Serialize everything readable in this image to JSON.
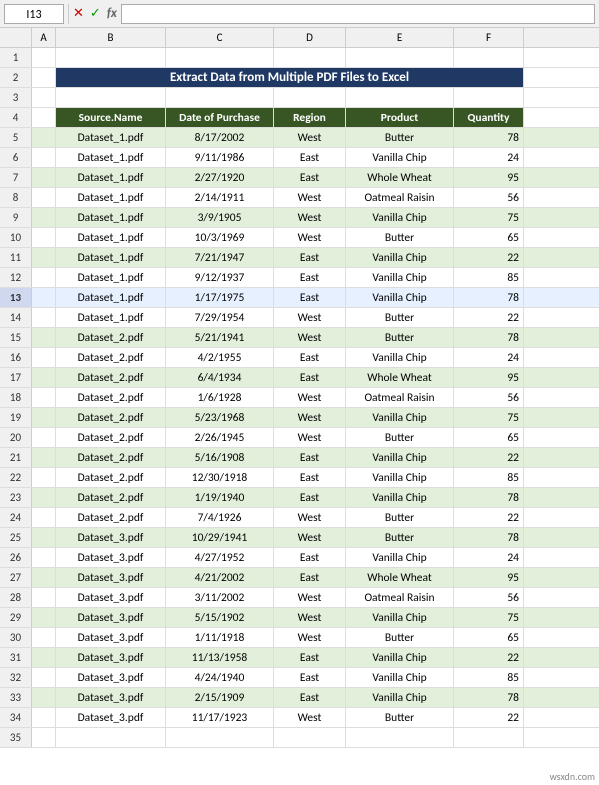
{
  "cellRef": "I13",
  "formulaBar": "",
  "title": "Extract Data from Multiple PDF Files to Excel",
  "columns": [
    {
      "id": "A",
      "label": "A",
      "class": "col-a"
    },
    {
      "id": "B",
      "label": "B",
      "class": "col-b"
    },
    {
      "id": "C",
      "label": "C",
      "class": "col-c"
    },
    {
      "id": "D",
      "label": "D",
      "class": "col-d"
    },
    {
      "id": "E",
      "label": "E",
      "class": "col-e"
    },
    {
      "id": "F",
      "label": "F",
      "class": "col-f"
    }
  ],
  "headers": [
    "Source.Name",
    "Date of Purchase",
    "Region",
    "Product",
    "Quantity"
  ],
  "rows": [
    {
      "num": 1,
      "type": "empty"
    },
    {
      "num": 2,
      "type": "title"
    },
    {
      "num": 3,
      "type": "empty"
    },
    {
      "num": 4,
      "type": "header"
    },
    {
      "num": 5,
      "type": "data",
      "src": "Dataset_1.pdf",
      "date": "8/17/2002",
      "region": "West",
      "product": "Butter",
      "qty": "78"
    },
    {
      "num": 6,
      "type": "data",
      "src": "Dataset_1.pdf",
      "date": "9/11/1986",
      "region": "East",
      "product": "Vanilla Chip",
      "qty": "24"
    },
    {
      "num": 7,
      "type": "data",
      "src": "Dataset_1.pdf",
      "date": "2/27/1920",
      "region": "East",
      "product": "Whole Wheat",
      "qty": "95"
    },
    {
      "num": 8,
      "type": "data",
      "src": "Dataset_1.pdf",
      "date": "2/14/1911",
      "region": "West",
      "product": "Oatmeal Raisin",
      "qty": "56"
    },
    {
      "num": 9,
      "type": "data",
      "src": "Dataset_1.pdf",
      "date": "3/9/1905",
      "region": "West",
      "product": "Vanilla Chip",
      "qty": "75"
    },
    {
      "num": 10,
      "type": "data",
      "src": "Dataset_1.pdf",
      "date": "10/3/1969",
      "region": "West",
      "product": "Butter",
      "qty": "65"
    },
    {
      "num": 11,
      "type": "data",
      "src": "Dataset_1.pdf",
      "date": "7/21/1947",
      "region": "East",
      "product": "Vanilla Chip",
      "qty": "22"
    },
    {
      "num": 12,
      "type": "data",
      "src": "Dataset_1.pdf",
      "date": "9/12/1937",
      "region": "East",
      "product": "Vanilla Chip",
      "qty": "85"
    },
    {
      "num": 13,
      "type": "data",
      "src": "Dataset_1.pdf",
      "date": "1/17/1975",
      "region": "East",
      "product": "Vanilla Chip",
      "qty": "78",
      "selected": true
    },
    {
      "num": 14,
      "type": "data",
      "src": "Dataset_1.pdf",
      "date": "7/29/1954",
      "region": "West",
      "product": "Butter",
      "qty": "22"
    },
    {
      "num": 15,
      "type": "data",
      "src": "Dataset_2.pdf",
      "date": "5/21/1941",
      "region": "West",
      "product": "Butter",
      "qty": "78"
    },
    {
      "num": 16,
      "type": "data",
      "src": "Dataset_2.pdf",
      "date": "4/2/1955",
      "region": "East",
      "product": "Vanilla Chip",
      "qty": "24"
    },
    {
      "num": 17,
      "type": "data",
      "src": "Dataset_2.pdf",
      "date": "6/4/1934",
      "region": "East",
      "product": "Whole Wheat",
      "qty": "95"
    },
    {
      "num": 18,
      "type": "data",
      "src": "Dataset_2.pdf",
      "date": "1/6/1928",
      "region": "West",
      "product": "Oatmeal Raisin",
      "qty": "56"
    },
    {
      "num": 19,
      "type": "data",
      "src": "Dataset_2.pdf",
      "date": "5/23/1968",
      "region": "West",
      "product": "Vanilla Chip",
      "qty": "75"
    },
    {
      "num": 20,
      "type": "data",
      "src": "Dataset_2.pdf",
      "date": "2/26/1945",
      "region": "West",
      "product": "Butter",
      "qty": "65"
    },
    {
      "num": 21,
      "type": "data",
      "src": "Dataset_2.pdf",
      "date": "5/16/1908",
      "region": "East",
      "product": "Vanilla Chip",
      "qty": "22"
    },
    {
      "num": 22,
      "type": "data",
      "src": "Dataset_2.pdf",
      "date": "12/30/1918",
      "region": "East",
      "product": "Vanilla Chip",
      "qty": "85"
    },
    {
      "num": 23,
      "type": "data",
      "src": "Dataset_2.pdf",
      "date": "1/19/1940",
      "region": "East",
      "product": "Vanilla Chip",
      "qty": "78"
    },
    {
      "num": 24,
      "type": "data",
      "src": "Dataset_2.pdf",
      "date": "7/4/1926",
      "region": "West",
      "product": "Butter",
      "qty": "22"
    },
    {
      "num": 25,
      "type": "data",
      "src": "Dataset_3.pdf",
      "date": "10/29/1941",
      "region": "West",
      "product": "Butter",
      "qty": "78"
    },
    {
      "num": 26,
      "type": "data",
      "src": "Dataset_3.pdf",
      "date": "4/27/1952",
      "region": "East",
      "product": "Vanilla Chip",
      "qty": "24"
    },
    {
      "num": 27,
      "type": "data",
      "src": "Dataset_3.pdf",
      "date": "4/21/2002",
      "region": "East",
      "product": "Whole Wheat",
      "qty": "95"
    },
    {
      "num": 28,
      "type": "data",
      "src": "Dataset_3.pdf",
      "date": "3/11/2002",
      "region": "West",
      "product": "Oatmeal Raisin",
      "qty": "56"
    },
    {
      "num": 29,
      "type": "data",
      "src": "Dataset_3.pdf",
      "date": "5/15/1902",
      "region": "West",
      "product": "Vanilla Chip",
      "qty": "75"
    },
    {
      "num": 30,
      "type": "data",
      "src": "Dataset_3.pdf",
      "date": "1/11/1918",
      "region": "West",
      "product": "Butter",
      "qty": "65"
    },
    {
      "num": 31,
      "type": "data",
      "src": "Dataset_3.pdf",
      "date": "11/13/1958",
      "region": "East",
      "product": "Vanilla Chip",
      "qty": "22"
    },
    {
      "num": 32,
      "type": "data",
      "src": "Dataset_3.pdf",
      "date": "4/24/1940",
      "region": "East",
      "product": "Vanilla Chip",
      "qty": "85"
    },
    {
      "num": 33,
      "type": "data",
      "src": "Dataset_3.pdf",
      "date": "2/15/1909",
      "region": "East",
      "product": "Vanilla Chip",
      "qty": "78"
    },
    {
      "num": 34,
      "type": "data",
      "src": "Dataset_3.pdf",
      "date": "11/17/1923",
      "region": "West",
      "product": "Butter",
      "qty": "22"
    },
    {
      "num": 35,
      "type": "empty"
    }
  ],
  "watermark": "wsxdn.com"
}
